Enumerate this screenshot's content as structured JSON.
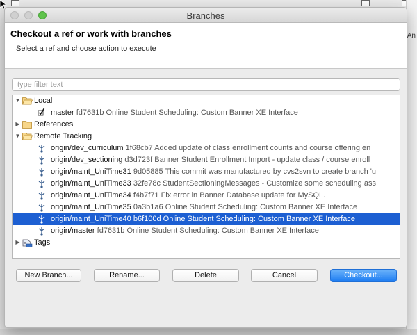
{
  "window": {
    "title": "Branches"
  },
  "header": {
    "title": "Checkout a ref or work with branches",
    "subtitle": "Select a ref and choose action to execute"
  },
  "filter": {
    "placeholder": "type filter text",
    "value": ""
  },
  "tree": {
    "local": {
      "label": "Local",
      "items": [
        {
          "name": "master",
          "commit": "fd7631b Online Student Scheduling: Custom Banner XE Interface"
        }
      ]
    },
    "references": {
      "label": "References"
    },
    "remote": {
      "label": "Remote Tracking",
      "items": [
        {
          "name": "origin/dev_curriculum",
          "commit": "1f68cb7 Added update of class enrollment counts and course offering en"
        },
        {
          "name": "origin/dev_sectioning",
          "commit": "d3d723f Banner Student Enrollment Import  - update class / course enroll"
        },
        {
          "name": "origin/maint_UniTime31",
          "commit": "9d05885 This commit was manufactured by cvs2svn to create branch 'u"
        },
        {
          "name": "origin/maint_UniTime33",
          "commit": "32fe78c StudentSectioningMessages - Customize some scheduling ass"
        },
        {
          "name": "origin/maint_UniTime34",
          "commit": "f4b7f71 Fix error in Banner Database update for MySQL."
        },
        {
          "name": "origin/maint_UniTime35",
          "commit": "0a3b1a6 Online Student Scheduling: Custom Banner XE Interface"
        },
        {
          "name": "origin/maint_UniTime40",
          "commit": "b6f100d Online Student Scheduling: Custom Banner XE Interface"
        },
        {
          "name": "origin/master",
          "commit": "fd7631b Online Student Scheduling: Custom Banner XE Interface"
        }
      ]
    },
    "tags": {
      "label": "Tags"
    }
  },
  "buttons": {
    "new_branch": "New Branch...",
    "rename": "Rename...",
    "delete": "Delete",
    "cancel": "Cancel",
    "checkout": "Checkout..."
  },
  "background": {
    "right_text": "An"
  },
  "colors": {
    "selection": "#1d5fd2",
    "primary_button": "#1d7cf2",
    "zoom_button": "#5fc34b"
  }
}
